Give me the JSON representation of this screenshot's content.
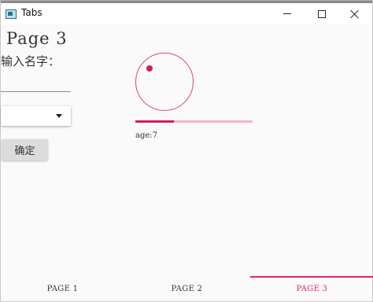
{
  "window": {
    "title": "Tabs",
    "accent_color": "#e91e63"
  },
  "page": {
    "title": "Page 3",
    "name_label": "输入名字：",
    "name_value": "",
    "dropdown_value": "",
    "ok_label": "确定",
    "age_text": "age:7",
    "progress_fraction": 0.33
  },
  "tabs": [
    {
      "label": "PAGE 1",
      "selected": false
    },
    {
      "label": "PAGE 2",
      "selected": false
    },
    {
      "label": "PAGE 3",
      "selected": true
    }
  ]
}
